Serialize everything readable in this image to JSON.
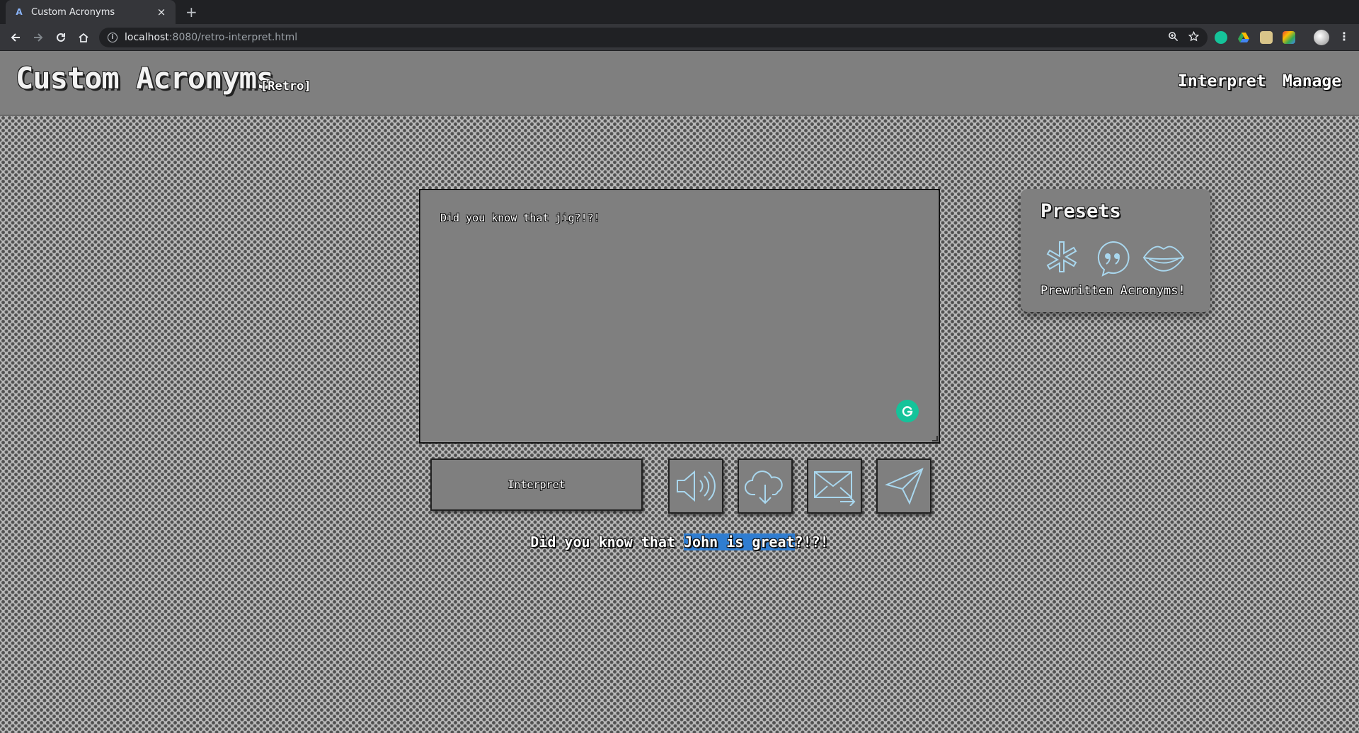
{
  "browser": {
    "tab_title": "Custom Acronyms",
    "tab_favicon": "A",
    "close_glyph": "×",
    "new_tab_glyph": "+",
    "url_host": "localhost",
    "url_path": ":8080/retro-interpret.html",
    "extension_icons": [
      "grammarly-icon",
      "google-drive-icon",
      "image-extension-icon",
      "colorful-extension-icon"
    ]
  },
  "header": {
    "brand": "Custom Acronyms",
    "brand_tag": "[Retro]",
    "nav": {
      "interpret": "Interpret",
      "manage": "Manage"
    }
  },
  "editor": {
    "text": "Did you know that jig?!?!"
  },
  "actions": {
    "interpret_label": "Interpret",
    "icons": [
      "speaker-icon",
      "cloud-download-icon",
      "email-forward-icon",
      "paper-plane-icon"
    ]
  },
  "output": {
    "before": "Did you know that ",
    "highlight": "John is great",
    "after": "?!?!"
  },
  "presets": {
    "title": "Presets",
    "caption": "Prewritten Acronyms!",
    "icons": [
      "asterisk-icon",
      "quote-bubble-icon",
      "lips-icon"
    ]
  },
  "colors": {
    "icon_stroke": "#a9d7ee",
    "highlight": "#2f7dd1",
    "panel": "#7f7f7f",
    "grammarly": "#15c39a"
  }
}
